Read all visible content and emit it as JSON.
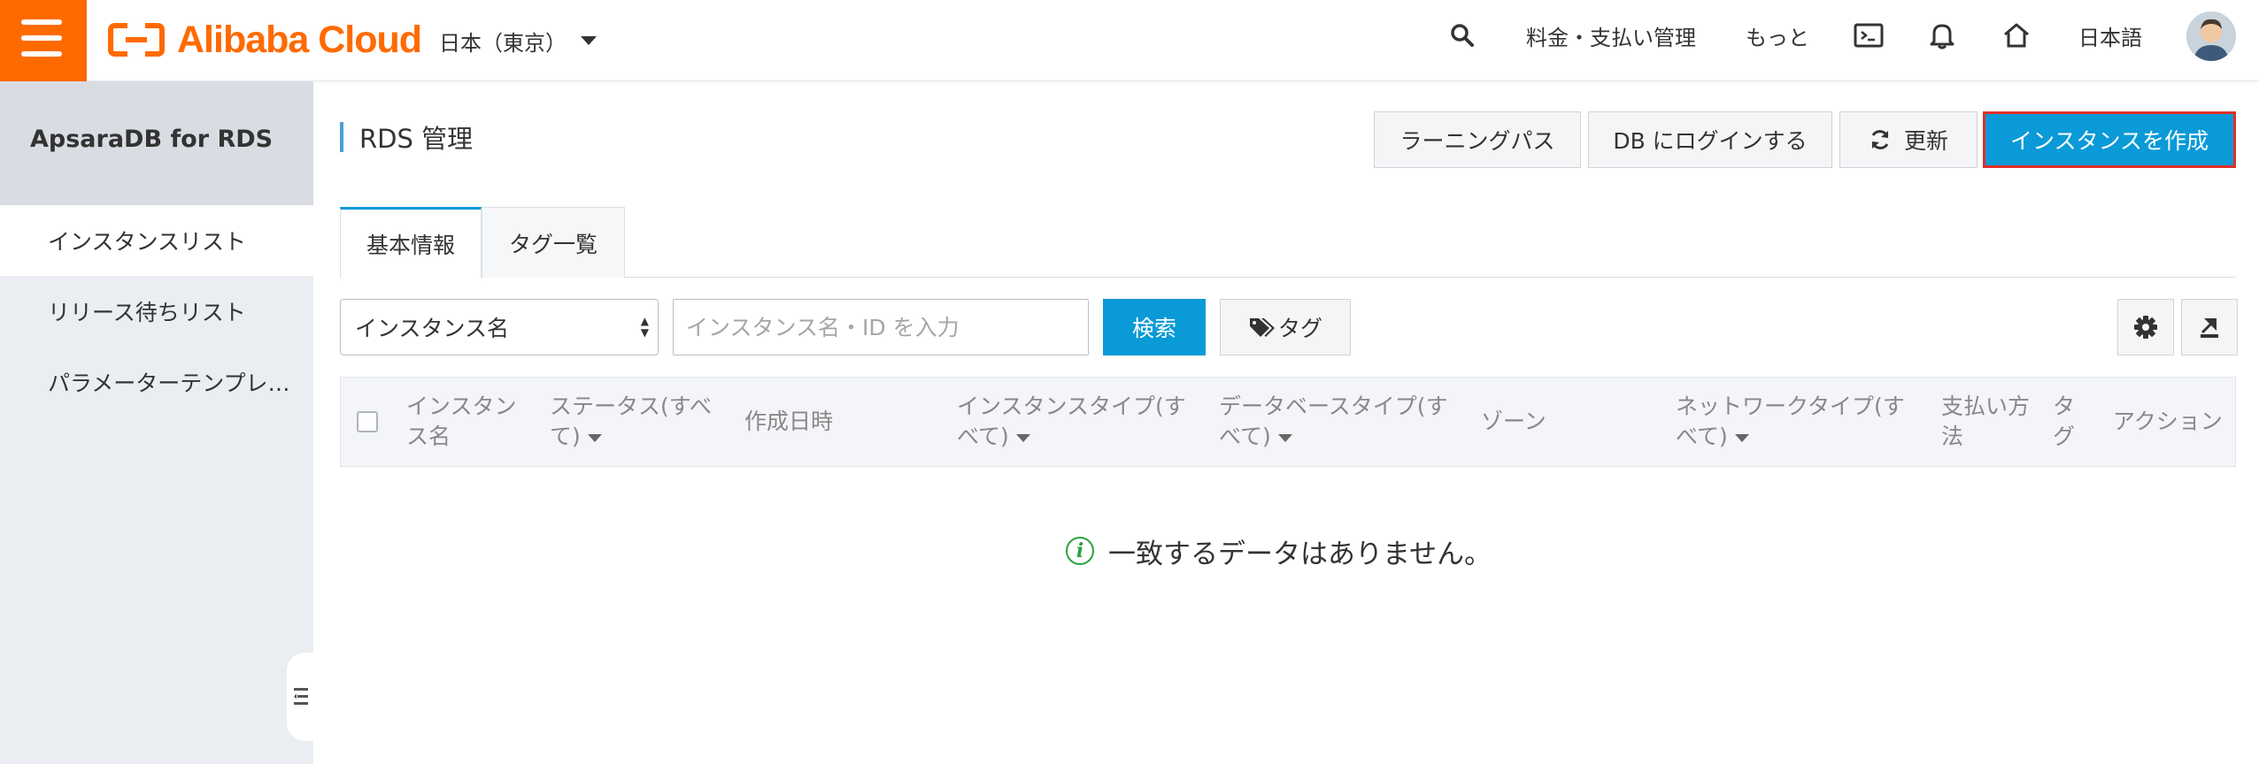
{
  "topbar": {
    "logo_text": "Alibaba Cloud",
    "region": "日本（東京）",
    "billing": "料金・支払い管理",
    "more": "もっと",
    "language": "日本語"
  },
  "sidebar": {
    "title": "ApsaraDB for RDS",
    "items": [
      {
        "label": "インスタンスリスト"
      },
      {
        "label": "リリース待ちリスト"
      },
      {
        "label": "パラメーターテンプレ…"
      }
    ]
  },
  "header": {
    "title": "RDS 管理",
    "buttons": {
      "learning": "ラーニングパス",
      "login_db": "DB にログインする",
      "refresh": "更新",
      "create": "インスタンスを作成"
    }
  },
  "tabs": [
    {
      "label": "基本情報"
    },
    {
      "label": "タグ一覧"
    }
  ],
  "filter": {
    "select_value": "インスタンス名",
    "input_placeholder": "インスタンス名・ID を入力",
    "search": "検索",
    "tag": "タグ"
  },
  "table": {
    "columns": [
      {
        "line1": "インスタン",
        "line2": "ス名"
      },
      {
        "line1": "ステータス(すべ",
        "line2": "て)"
      },
      {
        "line1": "作成日時"
      },
      {
        "line1": "インスタンスタイプ(す",
        "line2": "べて)"
      },
      {
        "line1": "データベースタイプ(す",
        "line2": "べて)"
      },
      {
        "line1": "ゾーン"
      },
      {
        "line1": "ネットワークタイプ(す",
        "line2": "べて)"
      },
      {
        "line1": "支払い方",
        "line2": "法"
      },
      {
        "line1": "タ",
        "line2": "グ"
      },
      {
        "line1": "アクション"
      }
    ],
    "empty_message": "一致するデータはありません。"
  },
  "colors": {
    "brand": "#ff6a00",
    "primary": "#0a9ad7",
    "create_border": "#e0302a",
    "info": "#2aa23e"
  }
}
